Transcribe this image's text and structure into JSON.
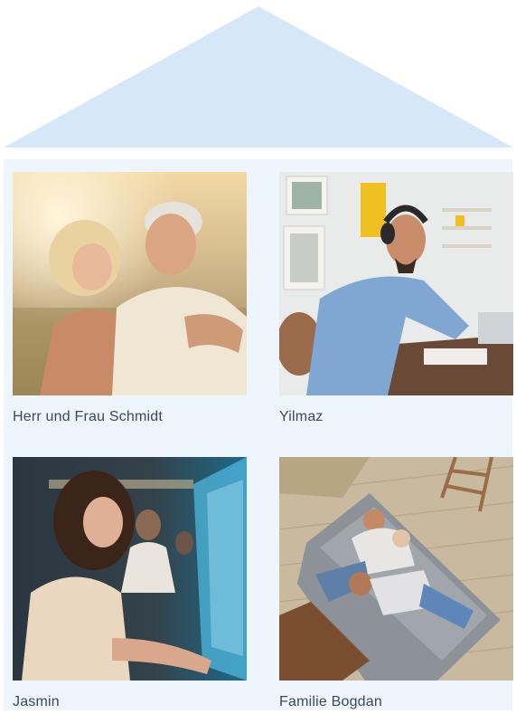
{
  "colors": {
    "roof": "#d6e8f8",
    "house_body": "#eef5fc",
    "caption_text": "#3a4a5e"
  },
  "cards": [
    {
      "caption": "Herr und Frau Schmidt",
      "image": "elderly-couple-embracing-photo"
    },
    {
      "caption": "Yilmaz",
      "image": "man-with-headphones-at-desk-photo"
    },
    {
      "caption": "Jasmin",
      "image": "woman-at-computer-screens-photo"
    },
    {
      "caption": "Familie Bogdan",
      "image": "family-on-sofa-photo"
    }
  ]
}
